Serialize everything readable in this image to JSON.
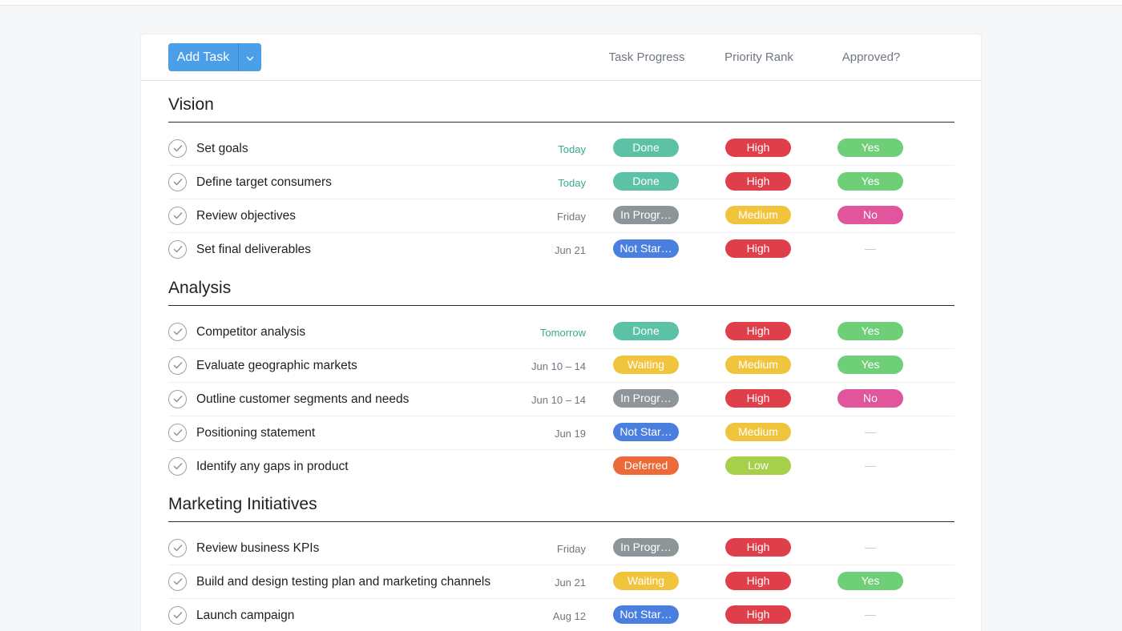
{
  "toolbar": {
    "add_task_label": "Add Task",
    "columns": [
      "Task Progress",
      "Priority Rank",
      "Approved?"
    ]
  },
  "colors": {
    "Done": "#5cc2a5",
    "In Progress": "#8d9599",
    "Not Started": "#4a7fe0",
    "Waiting": "#f0c43d",
    "Deferred": "#ec6a3a",
    "High": "#df3f4b",
    "Medium": "#f0c43d",
    "Low": "#a6cf4a",
    "Yes": "#6fcf78",
    "No": "#e0559c"
  },
  "sections": [
    {
      "title": "Vision",
      "tasks": [
        {
          "name": "Set goals",
          "due": "Today",
          "due_green": true,
          "progress": "Done",
          "progress_label": "Done",
          "priority": "High",
          "approved": "Yes"
        },
        {
          "name": "Define target consumers",
          "due": "Today",
          "due_green": true,
          "progress": "Done",
          "progress_label": "Done",
          "priority": "High",
          "approved": "Yes"
        },
        {
          "name": "Review objectives",
          "due": "Friday",
          "due_green": false,
          "progress": "In Progress",
          "progress_label": "In Progr…",
          "priority": "Medium",
          "approved": "No"
        },
        {
          "name": "Set final deliverables",
          "due": "Jun 21",
          "due_green": false,
          "progress": "Not Started",
          "progress_label": "Not Star…",
          "priority": "High",
          "approved": "—"
        }
      ]
    },
    {
      "title": "Analysis",
      "tasks": [
        {
          "name": "Competitor analysis",
          "due": "Tomorrow",
          "due_green": true,
          "progress": "Done",
          "progress_label": "Done",
          "priority": "High",
          "approved": "Yes"
        },
        {
          "name": "Evaluate geographic markets",
          "due": "Jun 10 – 14",
          "due_green": false,
          "progress": "Waiting",
          "progress_label": "Waiting",
          "priority": "Medium",
          "approved": "Yes"
        },
        {
          "name": "Outline customer segments and needs",
          "due": "Jun 10 – 14",
          "due_green": false,
          "progress": "In Progress",
          "progress_label": "In Progr…",
          "priority": "High",
          "approved": "No"
        },
        {
          "name": "Positioning statement",
          "due": "Jun 19",
          "due_green": false,
          "progress": "Not Started",
          "progress_label": "Not Star…",
          "priority": "Medium",
          "approved": "—"
        },
        {
          "name": "Identify any gaps in product",
          "due": "",
          "due_green": false,
          "progress": "Deferred",
          "progress_label": "Deferred",
          "priority": "Low",
          "approved": "—"
        }
      ]
    },
    {
      "title": "Marketing Initiatives",
      "tasks": [
        {
          "name": "Review business KPIs",
          "due": "Friday",
          "due_green": false,
          "progress": "In Progress",
          "progress_label": "In Progr…",
          "priority": "High",
          "approved": "—"
        },
        {
          "name": "Build and design testing plan and marketing channels",
          "due": "Jun 21",
          "due_green": false,
          "progress": "Waiting",
          "progress_label": "Waiting",
          "priority": "High",
          "approved": "Yes"
        },
        {
          "name": "Launch campaign",
          "due": "Aug 12",
          "due_green": false,
          "progress": "Not Started",
          "progress_label": "Not Star…",
          "priority": "High",
          "approved": "—"
        }
      ]
    }
  ]
}
